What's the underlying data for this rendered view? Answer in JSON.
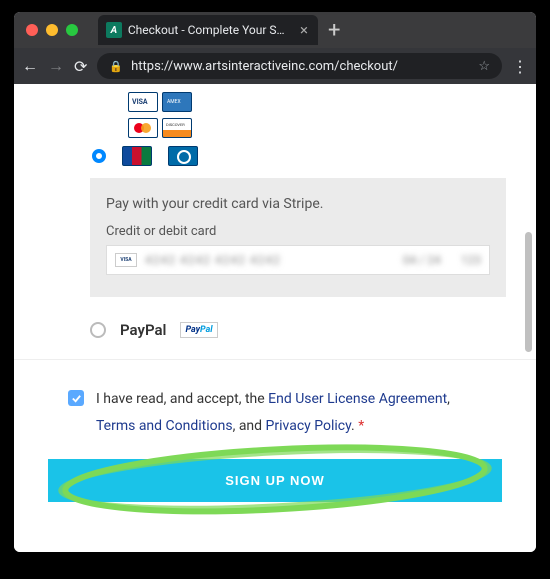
{
  "browser": {
    "tab_title": "Checkout - Complete Your Sub",
    "url": "https://www.artsinteractiveinc.com/checkout/"
  },
  "payment": {
    "stripe_desc": "Pay with your credit card via Stripe.",
    "card_label": "Credit or debit card",
    "masked_number": "4242 4242 4242 4242",
    "masked_exp": "04 / 24",
    "masked_cvc": "123",
    "paypal_label": "PayPal"
  },
  "terms": {
    "prefix": "I have read, and accept, the ",
    "eula": "End User License Agreement",
    "sep1": ", ",
    "tcs": "Terms and Conditions",
    "sep2": ", and ",
    "privacy": "Privacy Policy",
    "suffix": ". ",
    "required": "*"
  },
  "cta": {
    "label": "SIGN UP NOW"
  }
}
